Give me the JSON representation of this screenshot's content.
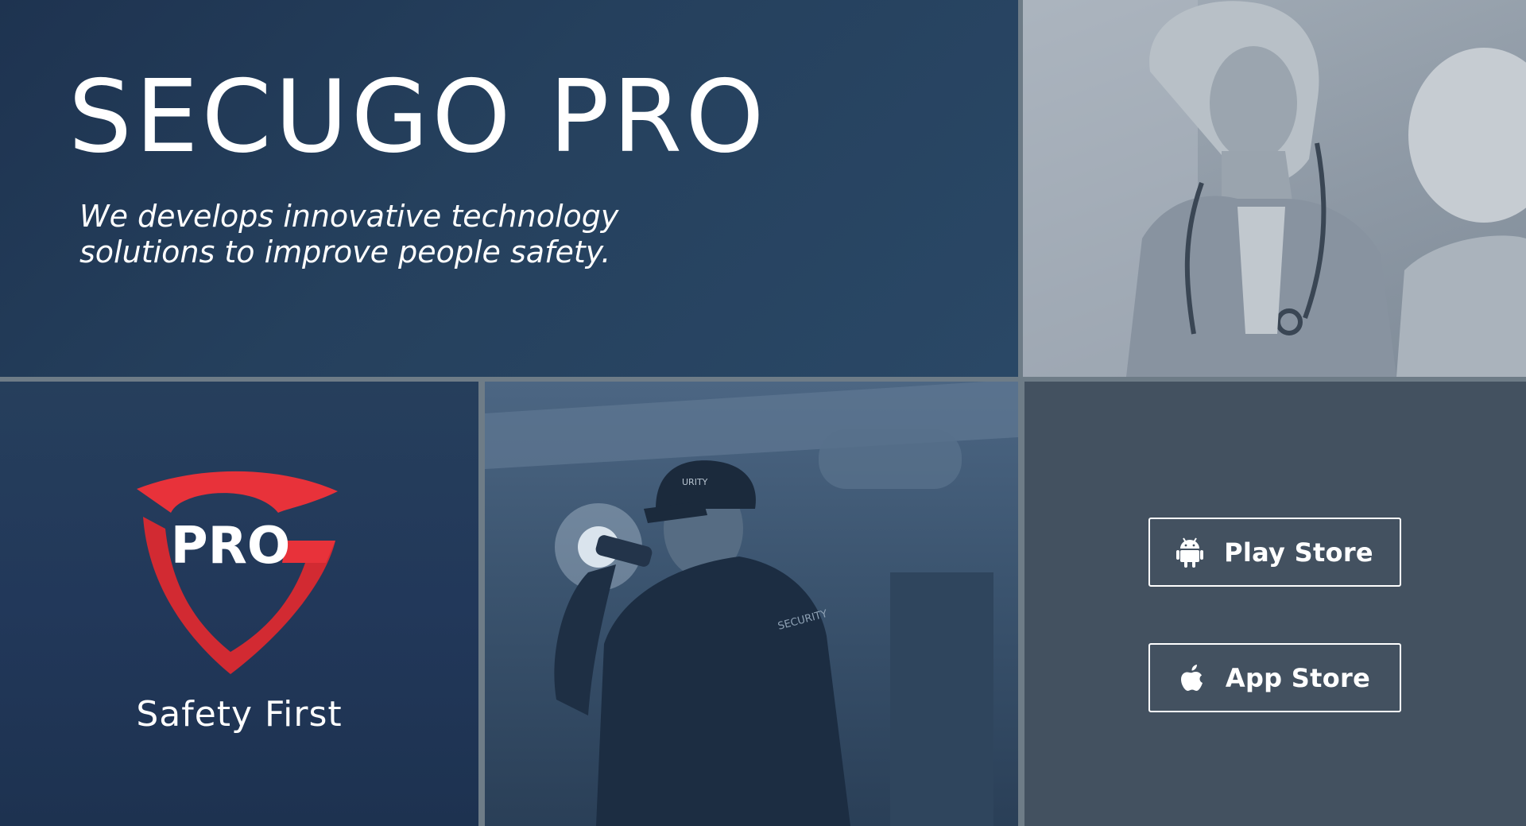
{
  "hero": {
    "title": "SECUGO PRO",
    "tagline_line1": "We develops innovative technology",
    "tagline_line2": "solutions to improve people safety."
  },
  "logo": {
    "mark_text": "PRO",
    "tagline": "Safety First"
  },
  "security_photo": {
    "cap_text": "URITY",
    "jacket_text": "SECURITY"
  },
  "stores": {
    "play": {
      "label": "Play Store",
      "icon": "android-icon"
    },
    "app": {
      "label": "App Store",
      "icon": "apple-icon"
    }
  },
  "colors": {
    "hero_bg": "#25405d",
    "logo_red": "#e8323a",
    "store_panel_bg": "#435160",
    "divider": "#6e7c87"
  }
}
